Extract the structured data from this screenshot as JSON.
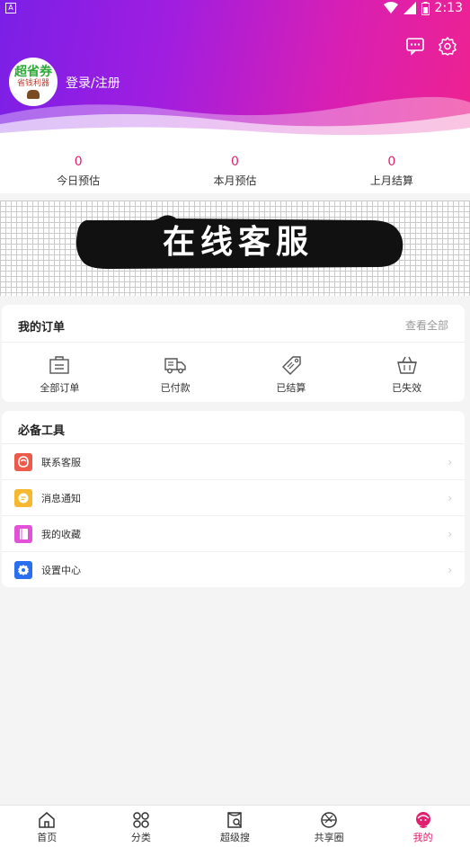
{
  "status_bar": {
    "time": "2:13",
    "left_badge": "A"
  },
  "header": {
    "avatar_text_line1": "超省券",
    "avatar_text_line2": "省钱利器",
    "login_label": "登录/注册",
    "icons": [
      "message-icon",
      "settings-icon"
    ]
  },
  "stats": [
    {
      "value": "0",
      "label": "今日预估"
    },
    {
      "value": "0",
      "label": "本月预估"
    },
    {
      "value": "0",
      "label": "上月结算"
    }
  ],
  "banner": {
    "text": "在线客服"
  },
  "orders": {
    "title": "我的订单",
    "view_all": "查看全部",
    "items": [
      {
        "label": "全部订单",
        "icon": "bag-icon"
      },
      {
        "label": "已付款",
        "icon": "truck-icon"
      },
      {
        "label": "已结算",
        "icon": "tag-icon"
      },
      {
        "label": "已失效",
        "icon": "basket-icon"
      }
    ]
  },
  "tools": {
    "title": "必备工具",
    "items": [
      {
        "label": "联系客服",
        "icon": "customer-service-icon",
        "color": "#ec5b4a"
      },
      {
        "label": "消息通知",
        "icon": "notification-icon",
        "color": "#f5b82e"
      },
      {
        "label": "我的收藏",
        "icon": "favorites-icon",
        "color": "#e351d8"
      },
      {
        "label": "设置中心",
        "icon": "settings-center-icon",
        "color": "#2a6ff0"
      }
    ]
  },
  "tabbar": {
    "tabs": [
      {
        "label": "首页",
        "icon": "home-icon"
      },
      {
        "label": "分类",
        "icon": "category-icon"
      },
      {
        "label": "超级搜",
        "icon": "super-search-icon"
      },
      {
        "label": "共享圈",
        "icon": "share-circle-icon"
      },
      {
        "label": "我的",
        "icon": "profile-icon"
      }
    ],
    "active_index": 4
  },
  "colors": {
    "accent": "#e0206e",
    "header_start": "#7b1fe6",
    "header_end": "#ee2290"
  }
}
